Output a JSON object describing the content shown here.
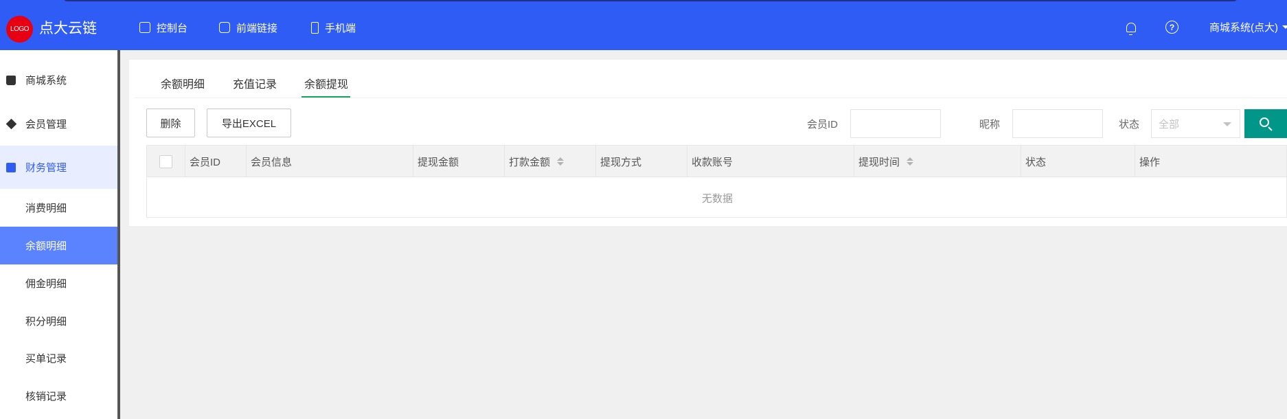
{
  "header": {
    "logo_text": "LOGO",
    "brand": "点大云链",
    "nav": [
      {
        "label": "控制台",
        "icon": "dashboard-icon"
      },
      {
        "label": "前端链接",
        "icon": "link-icon"
      },
      {
        "label": "手机端",
        "icon": "mobile-icon"
      }
    ],
    "user": "商城系统(点大)",
    "colors": {
      "bar": "#2f5cf5",
      "logo": "#e60012"
    }
  },
  "sidebar": {
    "groups": [
      {
        "label": "商城系统",
        "icon": "bag-icon"
      },
      {
        "label": "会员管理",
        "icon": "diamond-icon"
      },
      {
        "label": "财务管理",
        "icon": "wallet-icon",
        "active": true
      }
    ],
    "subitems": [
      {
        "label": "消费明细"
      },
      {
        "label": "余额明细",
        "active": true
      },
      {
        "label": "佣金明细"
      },
      {
        "label": "积分明细"
      },
      {
        "label": "买单记录"
      },
      {
        "label": "核销记录"
      }
    ]
  },
  "tabs": [
    {
      "label": "余额明细"
    },
    {
      "label": "充值记录"
    },
    {
      "label": "余额提现",
      "active": true
    }
  ],
  "toolbar": {
    "delete_label": "删除",
    "export_label": "导出EXCEL"
  },
  "filters": {
    "member_id_label": "会员ID",
    "member_id_value": "",
    "nickname_label": "昵称",
    "nickname_value": "",
    "status_label": "状态",
    "status_selected": "全部"
  },
  "table": {
    "columns": [
      "会员ID",
      "会员信息",
      "提现金额",
      "打款金额",
      "提现方式",
      "收款账号",
      "提现时间",
      "状态",
      "操作"
    ],
    "empty_text": "无数据"
  },
  "accent_colors": {
    "search_button": "#009688",
    "tab_underline": "#13a35a",
    "active_subitem": "#5b82ff"
  }
}
